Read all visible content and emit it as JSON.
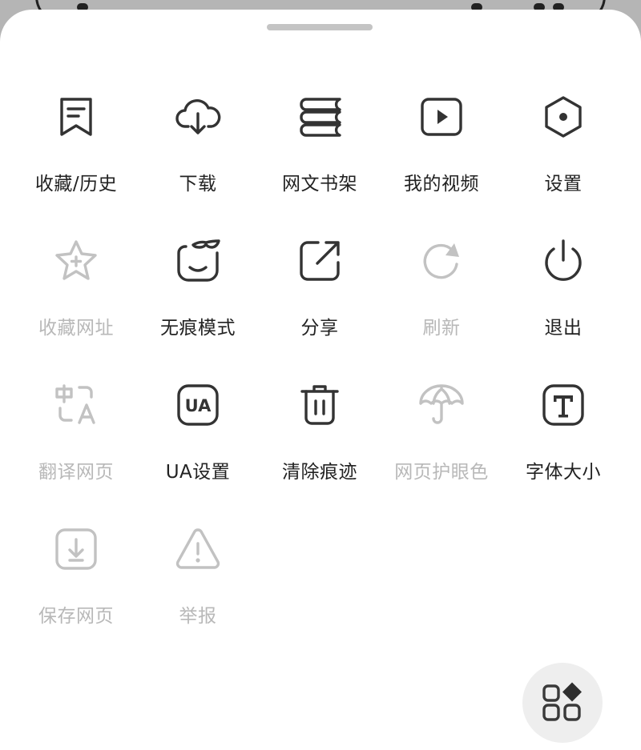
{
  "menu": {
    "items": [
      {
        "id": "favorites-history",
        "label": "收藏/历史",
        "icon": "bookmark-icon",
        "enabled": true
      },
      {
        "id": "download",
        "label": "下载",
        "icon": "cloud-download-icon",
        "enabled": true
      },
      {
        "id": "bookshelf",
        "label": "网文书架",
        "icon": "books-icon",
        "enabled": true
      },
      {
        "id": "my-videos",
        "label": "我的视频",
        "icon": "play-icon",
        "enabled": true
      },
      {
        "id": "settings",
        "label": "设置",
        "icon": "hexagon-gear-icon",
        "enabled": true
      },
      {
        "id": "bookmark-url",
        "label": "收藏网址",
        "icon": "star-plus-icon",
        "enabled": false
      },
      {
        "id": "incognito",
        "label": "无痕模式",
        "icon": "incognito-face-icon",
        "enabled": true
      },
      {
        "id": "share",
        "label": "分享",
        "icon": "share-icon",
        "enabled": true
      },
      {
        "id": "refresh",
        "label": "刷新",
        "icon": "refresh-icon",
        "enabled": false
      },
      {
        "id": "exit",
        "label": "退出",
        "icon": "power-icon",
        "enabled": true
      },
      {
        "id": "translate",
        "label": "翻译网页",
        "icon": "translate-icon",
        "enabled": false
      },
      {
        "id": "ua-settings",
        "label": "UA设置",
        "icon": "ua-icon",
        "enabled": true,
        "icon_text": "UA"
      },
      {
        "id": "clear-traces",
        "label": "清除痕迹",
        "icon": "trash-icon",
        "enabled": true
      },
      {
        "id": "eye-protection",
        "label": "网页护眼色",
        "icon": "umbrella-icon",
        "enabled": false
      },
      {
        "id": "font-size",
        "label": "字体大小",
        "icon": "font-size-icon",
        "enabled": true,
        "icon_text": "T"
      },
      {
        "id": "save-page",
        "label": "保存网页",
        "icon": "save-download-icon",
        "enabled": false
      },
      {
        "id": "report",
        "label": "举报",
        "icon": "warning-icon",
        "enabled": false
      }
    ]
  },
  "fab": {
    "icon": "apps-grid-icon"
  },
  "colors": {
    "enabled": "#333333",
    "disabled": "#c2c2c2",
    "sheet": "#ffffff",
    "backdrop": "#b9b9b9"
  }
}
